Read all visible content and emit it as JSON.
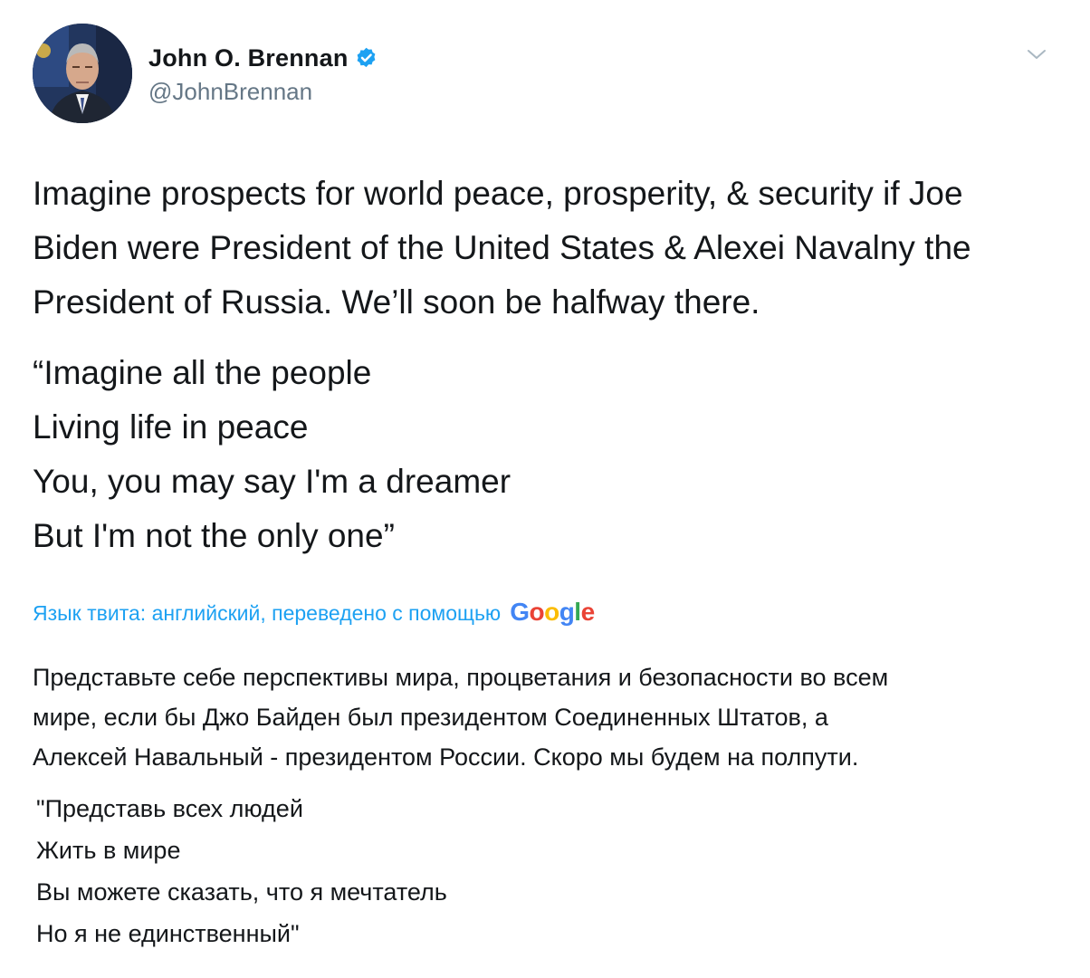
{
  "author": {
    "display_name": "John O. Brennan",
    "handle": "@JohnBrennan",
    "verified": true
  },
  "tweet": {
    "paragraph": [
      "Imagine prospects for world peace, prosperity, & security if Joe",
      "Biden were President of the United States & Alexei Navalny the",
      "President of Russia. We’ll soon be halfway there."
    ],
    "poem": [
      "“Imagine all the people",
      "Living life in peace",
      "You, you may say I'm a dreamer",
      "But I'm not the only one”"
    ]
  },
  "translation_notice": {
    "text": "Язык твита: английский, переведено с помощью",
    "provider": "Google",
    "provider_letters": [
      "G",
      "o",
      "o",
      "g",
      "l",
      "e"
    ]
  },
  "translation": {
    "paragraph": [
      "Представьте себе перспективы мира, процветания и безопасности во всем",
      "мире, если бы Джо Байден был президентом Соединенных Штатов, а",
      "Алексей Навальный - президентом России. Скоро мы будем на полпути."
    ],
    "poem": [
      "\"Представь всех людей",
      "Жить в мире",
      "Вы можете сказать, что я мечтатель",
      "Но я не единственный\""
    ]
  },
  "colors": {
    "link_blue": "#1da1f2",
    "text": "#14171a",
    "secondary": "#657786"
  },
  "icons": {
    "verified": "verified-badge-icon",
    "menu": "chevron-down-icon"
  }
}
